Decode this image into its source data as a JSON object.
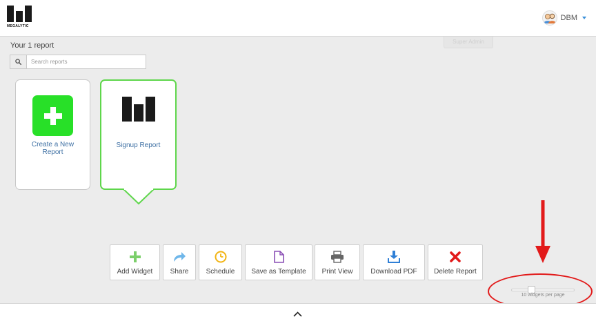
{
  "app": {
    "logo_text": "MEGALYTIC",
    "user_name": "DBM",
    "super_admin_label": "Super Admin"
  },
  "reports": {
    "heading": "Your 1 report",
    "search": {
      "placeholder": "Search reports",
      "value": ""
    },
    "cards": [
      {
        "label": "Create a New Report",
        "icon": "plus-icon"
      },
      {
        "label": "Signup Report",
        "icon": "megalytic-logo-icon"
      }
    ]
  },
  "toolbar": {
    "buttons": [
      {
        "label": "Add Widget",
        "icon": "plus-icon",
        "color": "#7ccf6b"
      },
      {
        "label": "Share",
        "icon": "share-arrow-icon",
        "color": "#6fb7ea"
      },
      {
        "label": "Schedule",
        "icon": "clock-icon",
        "color": "#f2b413"
      },
      {
        "label": "Save as Template",
        "icon": "document-icon",
        "color": "#8a4fb5"
      },
      {
        "label": "Print View",
        "icon": "printer-icon",
        "color": "#666666"
      },
      {
        "label": "Download PDF",
        "icon": "download-icon",
        "color": "#2f7fd6"
      },
      {
        "label": "Delete Report",
        "icon": "x-icon",
        "color": "#e21a1a"
      }
    ]
  },
  "pagination": {
    "widgets_per_page_label": "10 widgets per page",
    "widgets_per_page": 10
  },
  "colors": {
    "accent_green": "#28e028",
    "selected_border": "#5ed64b",
    "link_blue": "#3d6fa3",
    "annotation_red": "#e21a1a"
  }
}
